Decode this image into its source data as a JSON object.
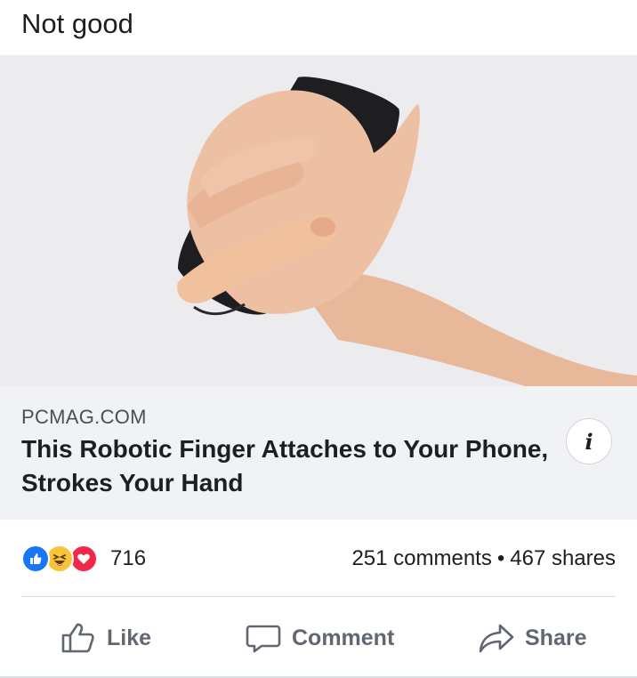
{
  "post": {
    "text": "Not good"
  },
  "link": {
    "domain": "PCMAG.COM",
    "title": "This Robotic Finger Attaches to Your Phone, Strokes Your Hand",
    "info_label": "i",
    "image_icon": "photo-of-hand-holding-phone-with-robotic-finger"
  },
  "reactions": {
    "types": [
      "like",
      "haha",
      "love"
    ],
    "count": "716",
    "comments": "251 comments",
    "separator": "•",
    "shares": "467 shares"
  },
  "actions": {
    "like_label": "Like",
    "comment_label": "Comment",
    "share_label": "Share"
  },
  "colors": {
    "like_blue": "#1877f2",
    "haha_yellow": "#f7c43a",
    "love_red": "#f0284a",
    "action_gray": "#606770",
    "meta_bg": "#f0f2f5"
  }
}
